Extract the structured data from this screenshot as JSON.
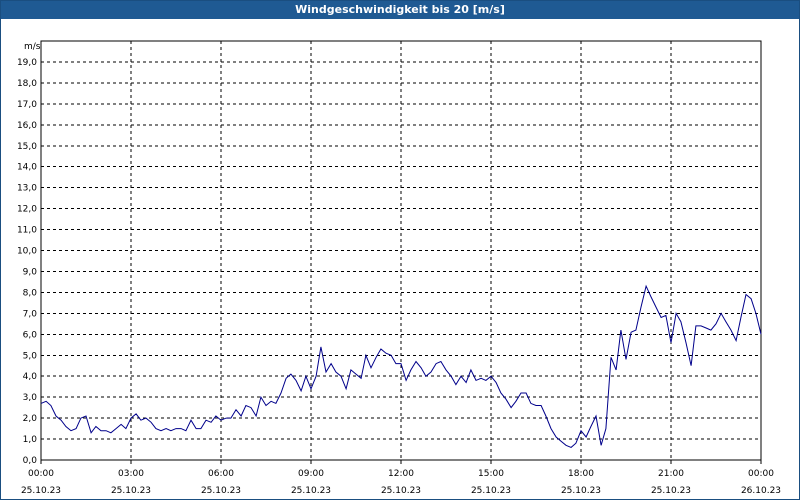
{
  "chart_data": {
    "type": "line",
    "title": "Windgeschwindigkeit bis 20 [m/s]",
    "ylabel": "m/s",
    "ylim": [
      0,
      20
    ],
    "xlim": [
      0,
      24
    ],
    "y_ticks": [
      "0,0",
      "1,0",
      "2,0",
      "3,0",
      "4,0",
      "5,0",
      "6,0",
      "7,0",
      "8,0",
      "9,0",
      "10,0",
      "11,0",
      "12,0",
      "13,0",
      "14,0",
      "15,0",
      "16,0",
      "17,0",
      "18,0",
      "19,0"
    ],
    "x_ticks": [
      {
        "time": "00:00",
        "date": "25.10.23"
      },
      {
        "time": "03:00",
        "date": "25.10.23"
      },
      {
        "time": "06:00",
        "date": "25.10.23"
      },
      {
        "time": "09:00",
        "date": "25.10.23"
      },
      {
        "time": "12:00",
        "date": "25.10.23"
      },
      {
        "time": "15:00",
        "date": "25.10.23"
      },
      {
        "time": "18:00",
        "date": "25.10.23"
      },
      {
        "time": "21:00",
        "date": "25.10.23"
      },
      {
        "time": "00:00",
        "date": "26.10.23"
      }
    ],
    "grid": true,
    "colors": {
      "line": "#00008b",
      "grid": "#000000",
      "title_bg": "#1f5a93"
    },
    "series": [
      {
        "x": [
          0.0,
          0.17,
          0.33,
          0.5,
          0.67,
          0.83,
          1.0,
          1.17,
          1.33,
          1.5,
          1.67,
          1.83,
          2.0,
          2.17,
          2.33,
          2.5,
          2.67,
          2.83,
          3.0,
          3.17,
          3.33,
          3.5,
          3.67,
          3.83,
          4.0,
          4.17,
          4.33,
          4.5,
          4.67,
          4.83,
          5.0,
          5.17,
          5.33,
          5.5,
          5.67,
          5.83,
          6.0,
          6.17,
          6.33,
          6.5,
          6.67,
          6.83,
          7.0,
          7.17,
          7.33,
          7.5,
          7.67,
          7.83,
          8.0,
          8.17,
          8.33,
          8.5,
          8.67,
          8.83,
          9.0,
          9.17,
          9.33,
          9.5,
          9.67,
          9.83,
          10.0,
          10.17,
          10.33,
          10.5,
          10.67,
          10.83,
          11.0,
          11.17,
          11.33,
          11.5,
          11.67,
          11.83,
          12.0,
          12.17,
          12.33,
          12.5,
          12.67,
          12.83,
          13.0,
          13.17,
          13.33,
          13.5,
          13.67,
          13.83,
          14.0,
          14.17,
          14.33,
          14.5,
          14.67,
          14.83,
          15.0,
          15.17,
          15.33,
          15.5,
          15.67,
          15.83,
          16.0,
          16.17,
          16.33,
          16.5,
          16.67,
          16.83,
          17.0,
          17.17,
          17.33,
          17.5,
          17.67,
          17.83,
          18.0,
          18.17,
          18.33,
          18.5,
          18.67,
          18.83,
          19.0,
          19.17,
          19.33,
          19.5,
          19.67,
          19.83,
          20.0,
          20.17,
          20.33,
          20.5,
          20.67,
          20.83,
          21.0,
          21.17,
          21.33,
          21.5,
          21.67,
          21.83,
          22.0,
          22.17,
          22.33,
          22.5,
          22.67,
          22.83,
          23.0,
          23.17,
          23.33,
          23.5,
          23.67,
          23.83,
          24.0
        ],
        "values": [
          2.7,
          2.8,
          2.6,
          2.1,
          1.9,
          1.6,
          1.4,
          1.5,
          2.0,
          2.1,
          1.3,
          1.6,
          1.4,
          1.4,
          1.3,
          1.5,
          1.7,
          1.5,
          2.0,
          2.2,
          1.9,
          2.0,
          1.8,
          1.5,
          1.4,
          1.5,
          1.4,
          1.5,
          1.5,
          1.4,
          1.9,
          1.5,
          1.5,
          1.9,
          1.8,
          2.1,
          1.9,
          2.0,
          2.0,
          2.4,
          2.1,
          2.6,
          2.5,
          2.1,
          3.0,
          2.6,
          2.8,
          2.7,
          3.2,
          3.9,
          4.1,
          3.8,
          3.3,
          4.0,
          3.4,
          4.0,
          5.4,
          4.2,
          4.6,
          4.2,
          4.0,
          3.4,
          4.3,
          4.1,
          3.9,
          5.0,
          4.4,
          4.9,
          5.3,
          5.1,
          5.0,
          4.6,
          4.6,
          3.8,
          4.3,
          4.7,
          4.4,
          4.0,
          4.2,
          4.6,
          4.7,
          4.3,
          4.0,
          3.6,
          4.0,
          3.7,
          4.3,
          3.8,
          3.9,
          3.8,
          4.0,
          3.7,
          3.2,
          2.9,
          2.5,
          2.8,
          3.2,
          3.2,
          2.7,
          2.6,
          2.6,
          2.1,
          1.5,
          1.1,
          0.9,
          0.7,
          0.6,
          0.8,
          1.4,
          1.1,
          1.6,
          2.1,
          0.7,
          1.5,
          4.9,
          4.3,
          6.2,
          4.8,
          6.1,
          6.2,
          7.3,
          8.3,
          7.8,
          7.3,
          6.8,
          6.9,
          5.6,
          7.0,
          6.6,
          5.6,
          4.5,
          6.4,
          6.4,
          6.3,
          6.2,
          6.5,
          7.0,
          6.6,
          6.2,
          5.7,
          6.8,
          7.9,
          7.7,
          7.0,
          6.0
        ]
      }
    ]
  }
}
